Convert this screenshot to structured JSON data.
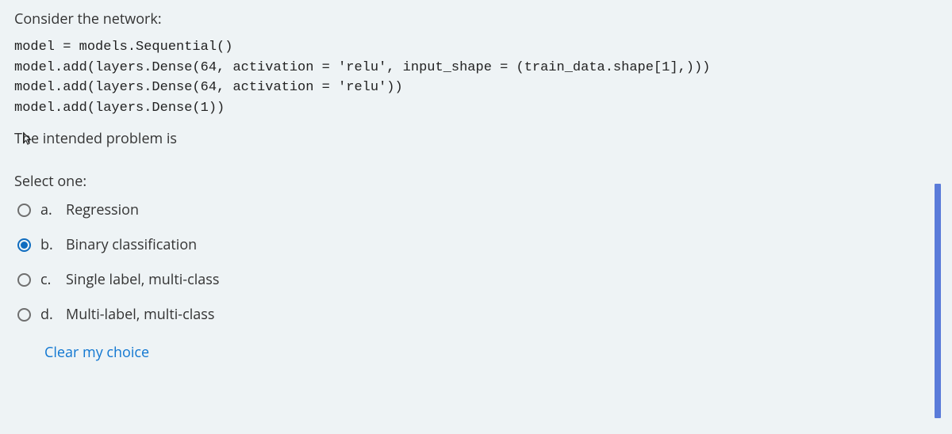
{
  "question": {
    "intro": "Consider the network:",
    "code": "model = models.Sequential()\nmodel.add(layers.Dense(64, activation = 'relu', input_shape = (train_data.shape[1],)))\nmodel.add(layers.Dense(64, activation = 'relu'))\nmodel.add(layers.Dense(1))",
    "outro": "The intended problem is"
  },
  "prompt": "Select one:",
  "options": [
    {
      "letter": "a.",
      "text": "Regression",
      "selected": false
    },
    {
      "letter": "b.",
      "text": "Binary classification",
      "selected": true
    },
    {
      "letter": "c.",
      "text": "Single label, multi-class",
      "selected": false
    },
    {
      "letter": "d.",
      "text": "Multi-label, multi-class",
      "selected": false
    }
  ],
  "clear_label": "Clear my choice"
}
